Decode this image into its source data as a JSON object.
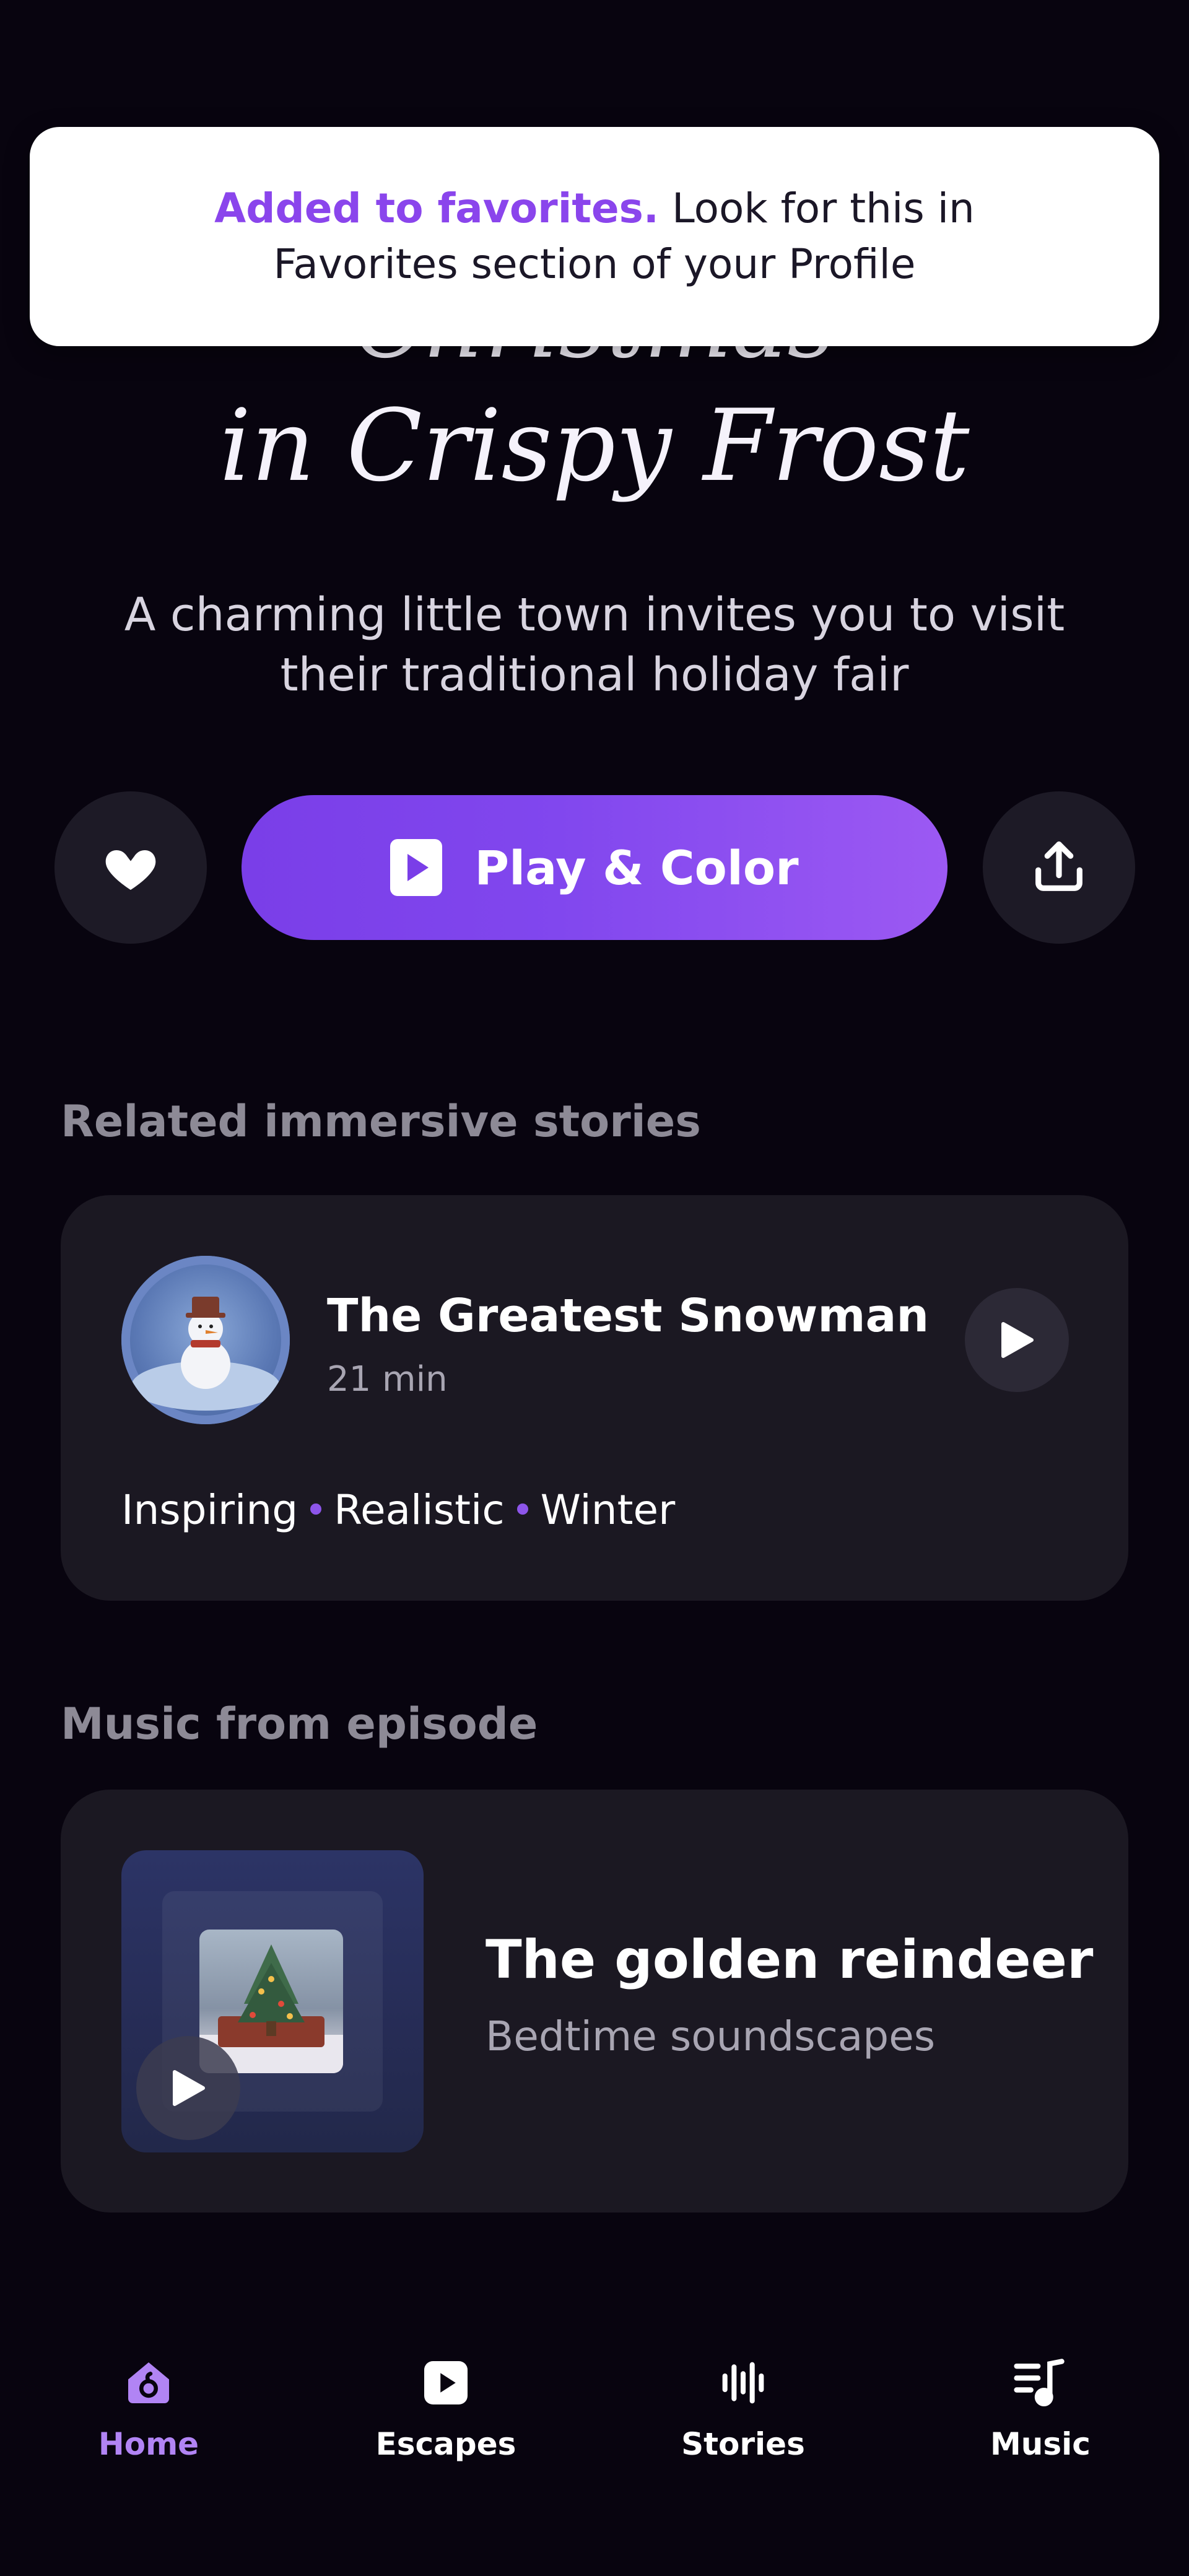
{
  "hero": {
    "title_line1": "Christmas",
    "title_line2": "in Crispy Frost",
    "subtitle": "A charming little town invites you to visit their traditional holiday fair"
  },
  "toast": {
    "highlight": "Added to favorites.",
    "message": " Look for this in Favorites section of your Profile"
  },
  "actions": {
    "play_label": "Play & Color",
    "favorite_icon": "heart-icon",
    "share_icon": "share-icon"
  },
  "related": {
    "heading": "Related immersive stories",
    "story": {
      "title": "The Greatest Snowman",
      "duration": "21 min",
      "tags": [
        "Inspiring",
        "Realistic",
        "Winter"
      ]
    }
  },
  "music": {
    "heading": "Music from episode",
    "track": {
      "title": "The golden reindeer",
      "subtitle": "Bedtime soundscapes"
    }
  },
  "nav": {
    "items": [
      {
        "label": "Home",
        "icon": "home-icon",
        "active": true
      },
      {
        "label": "Escapes",
        "icon": "escapes-icon",
        "active": false
      },
      {
        "label": "Stories",
        "icon": "stories-icon",
        "active": false
      },
      {
        "label": "Music",
        "icon": "music-icon",
        "active": false
      }
    ]
  },
  "colors": {
    "background": "#08040f",
    "accent": "#8a45ec",
    "card": "#1b1822",
    "active_nav": "#b184f4"
  }
}
